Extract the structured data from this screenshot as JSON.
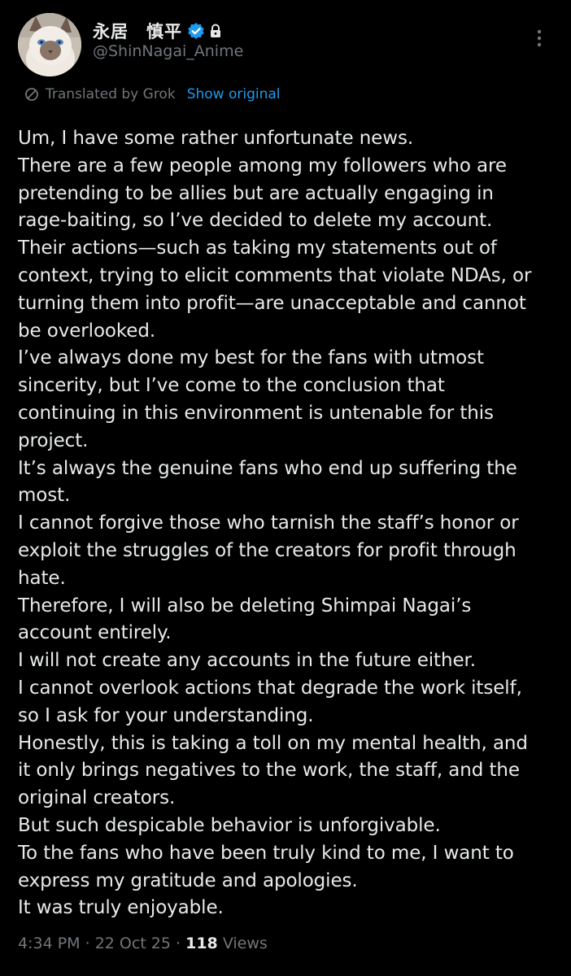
{
  "author": {
    "display_name": "永居　慎平",
    "handle": "@ShinNagai_Anime",
    "verified_icon": "verified-badge-icon",
    "protected_icon": "lock-icon"
  },
  "translation": {
    "label": "Translated by Grok",
    "show_original_label": "Show original",
    "icon": "translate-icon"
  },
  "tweet": {
    "lines": [
      "Um, I have some rather unfortunate news.",
      "There are a few people among my followers who are",
      "pretending to be allies but are actually engaging in",
      "rage-baiting, so I’ve decided to delete my account.",
      "Their actions—such as taking my statements out of",
      "context, trying to elicit comments that violate NDAs, or",
      "turning them into profit—are unacceptable and cannot",
      "be overlooked.",
      "I’ve always done my best for the fans with utmost",
      "sincerity, but I’ve come to the conclusion that",
      "continuing in this environment is untenable for this",
      "project.",
      "It’s always the genuine fans who end up suffering the",
      "most.",
      "I cannot forgive those who tarnish the staff’s honor or",
      "exploit the struggles of the creators for profit through",
      "hate.",
      "Therefore, I will also be deleting Shimpai Nagai’s",
      "account entirely.",
      "I will not create any accounts in the future either.",
      "I cannot overlook actions that degrade the work itself,",
      "so I ask for your understanding.",
      "Honestly, this is taking a toll on my mental health, and",
      "it only brings negatives to the work, the staff, and the",
      "original creators.",
      "But such despicable behavior is unforgivable.",
      "To the fans who have been truly kind to me, I want to",
      "express my gratitude and apologies.",
      "It was truly enjoyable."
    ]
  },
  "meta": {
    "time": "4:34 PM",
    "separator": " · ",
    "date": "22 Oct 25",
    "views_count": "118",
    "views_label": " Views"
  },
  "colors": {
    "background": "#000000",
    "text": "#e7e9ea",
    "muted": "#71767b",
    "accent": "#1d9bf0"
  }
}
